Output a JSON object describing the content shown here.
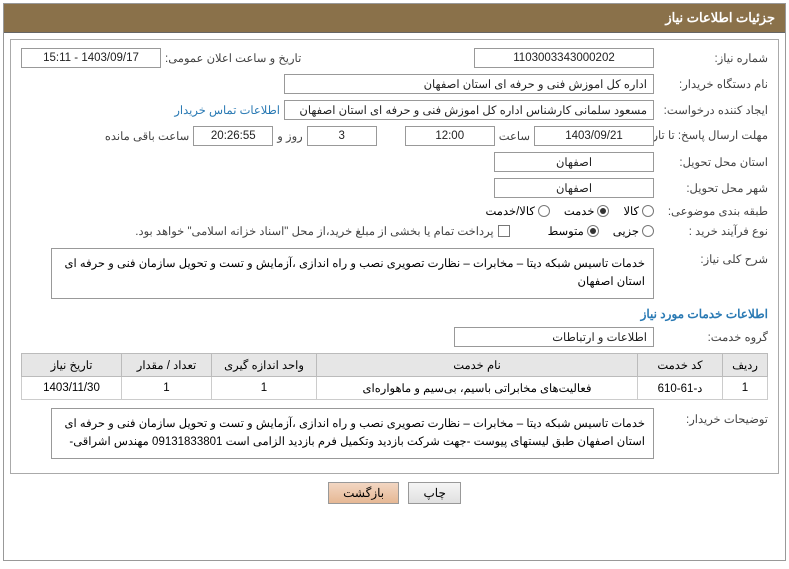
{
  "header": {
    "title": "جزئیات اطلاعات نیاز"
  },
  "labels": {
    "need_no": "شماره نیاز:",
    "announce_dt": "تاریخ و ساعت اعلان عمومی:",
    "buyer_org": "نام دستگاه خریدار:",
    "requester": "ایجاد کننده درخواست:",
    "buyer_contact": "اطلاعات تماس خریدار",
    "reply_deadline": "مهلت ارسال پاسخ: تا تاریخ:",
    "time": "ساعت",
    "days_and": "روز و",
    "time_left": "ساعت باقی مانده",
    "delivery_province": "استان محل تحویل:",
    "delivery_city": "شهر محل تحویل:",
    "category": "طبقه بندی موضوعی:",
    "cat_goods": "کالا",
    "cat_service": "خدمت",
    "cat_goods_service": "کالا/خدمت",
    "purchase_type": "نوع فرآیند خرید :",
    "pt_minor": "جزیی",
    "pt_medium": "متوسط",
    "payment_note": "پرداخت تمام یا بخشی از مبلغ خرید،از محل \"اسناد خزانه اسلامی\" خواهد بود.",
    "need_desc": "شرح کلی نیاز:",
    "services_info": "اطلاعات خدمات مورد نیاز",
    "service_group": "گروه خدمت:",
    "buyer_notes": "توضیحات خریدار:"
  },
  "fields": {
    "need_no": "1103003343000202",
    "announce_dt": "1403/09/17 - 15:11",
    "buyer_org": "اداره کل اموزش فنی و حرفه ای استان اصفهان",
    "requester": "مسعود سلمانی کارشناس اداره کل اموزش فنی و حرفه ای استان اصفهان",
    "deadline_date": "1403/09/21",
    "deadline_time": "12:00",
    "days_remaining": "3",
    "time_remaining": "20:26:55",
    "province": "اصفهان",
    "city": "اصفهان",
    "service_group": "اطلاعات و ارتباطات",
    "need_desc": "خدمات تاسیس شبکه دیتا – مخابرات – نظارت تصویری نصب و راه اندازی ،آزمایش و تست و تحویل سازمان فنی و حرفه ای استان اصفهان",
    "buyer_notes": "خدمات تاسیس شبکه دیتا – مخابرات – نظارت تصویری نصب و راه اندازی ،آزمایش و تست و تحویل سازمان فنی و حرفه ای استان اصفهان  طبق لیستهای پیوست -جهت شرکت بازدید وتکمیل فرم بازدید الزامی است 09131833801 مهندس اشراقی-"
  },
  "table": {
    "headers": {
      "row": "ردیف",
      "code": "کد خدمت",
      "name": "نام خدمت",
      "unit": "واحد اندازه گیری",
      "qty": "تعداد / مقدار",
      "need_date": "تاریخ نیاز"
    },
    "rows": [
      {
        "row": "1",
        "code": "د-61-610",
        "name": "فعالیت‌های مخابراتی باسیم، بی‌سیم و ماهواره‌ای",
        "unit": "1",
        "qty": "1",
        "need_date": "1403/11/30"
      }
    ]
  },
  "buttons": {
    "print": "چاپ",
    "back": "بازگشت"
  }
}
